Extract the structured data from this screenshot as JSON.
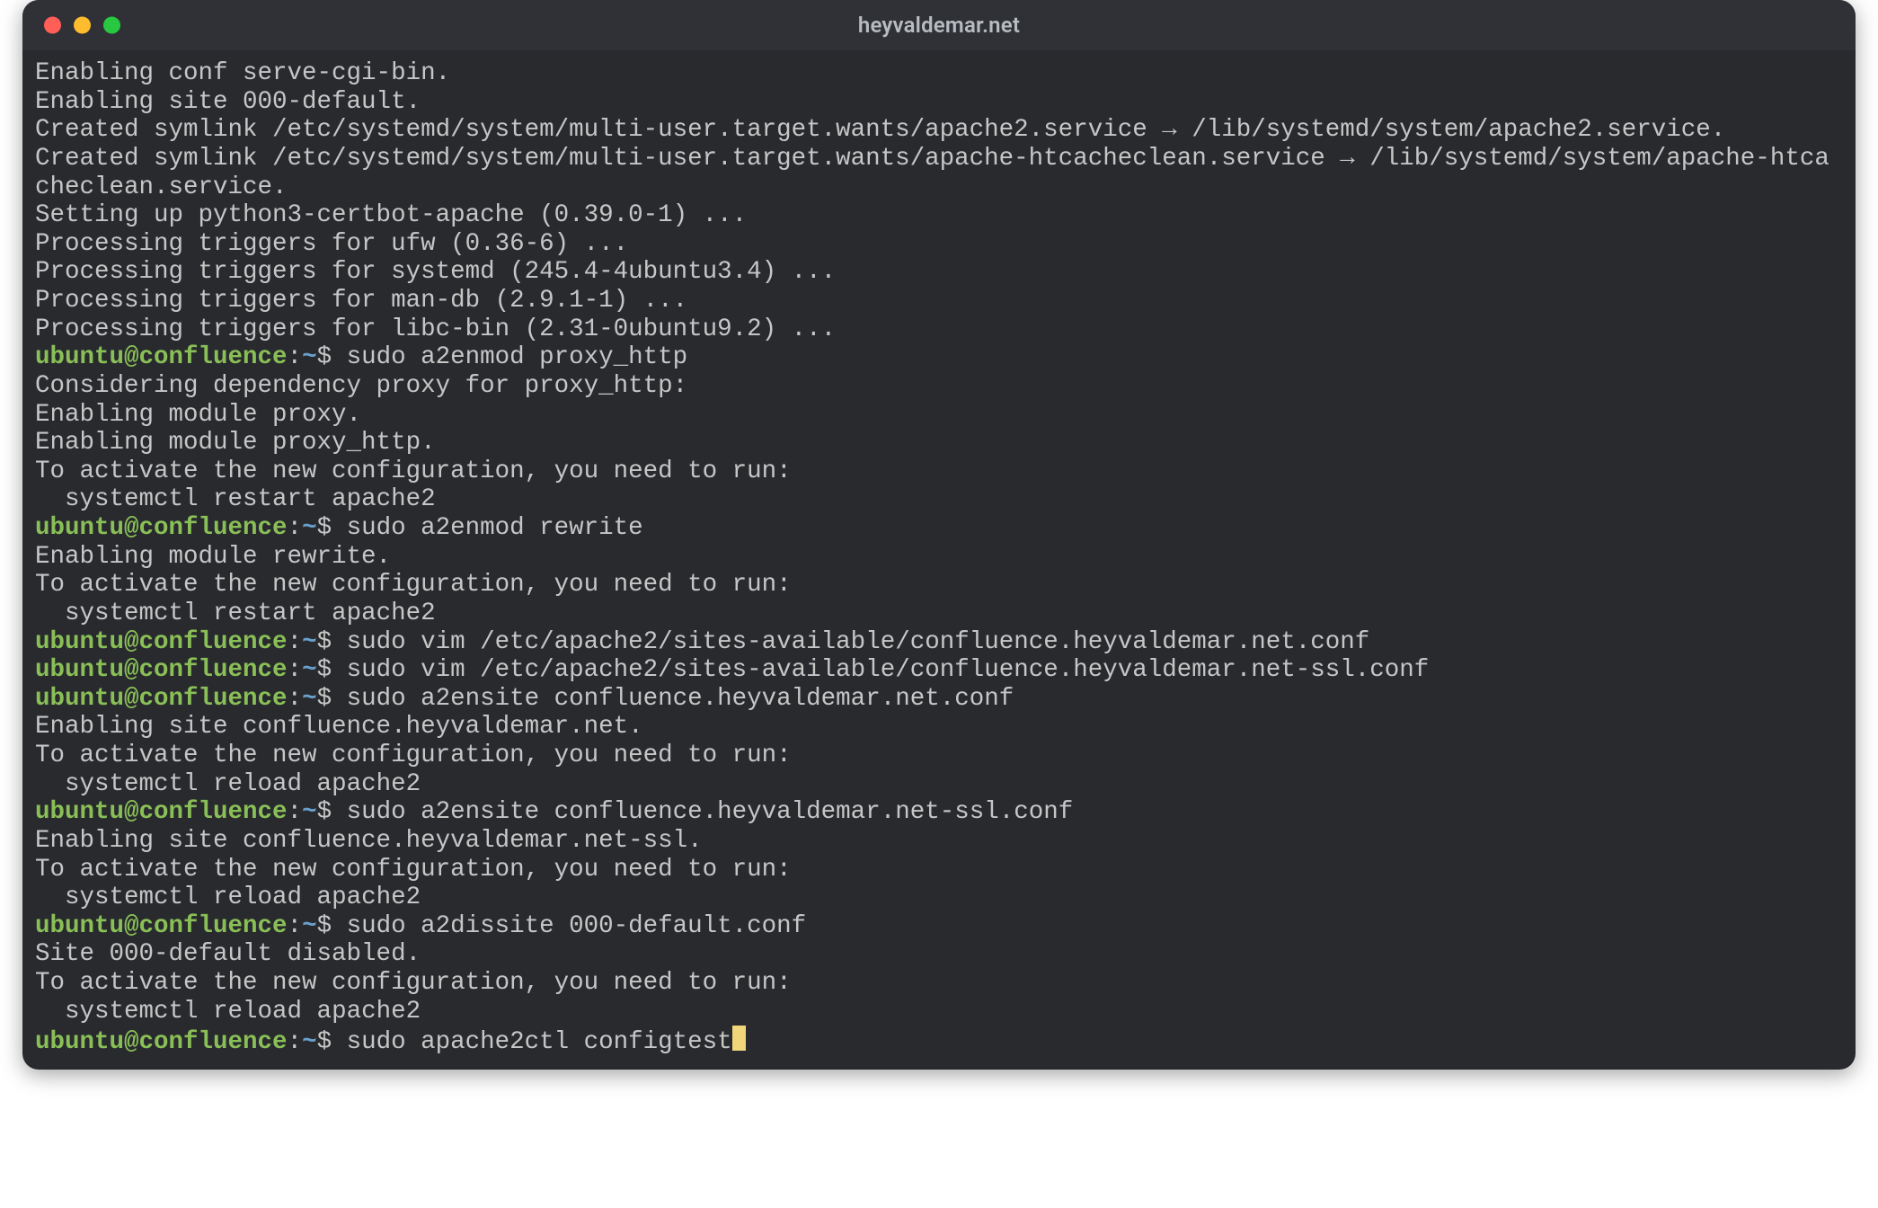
{
  "window": {
    "title": "heyvaldemar.net"
  },
  "prompt": {
    "user_host": "ubuntu@confluence",
    "colon": ":",
    "cwd": "~",
    "dollar": "$ "
  },
  "lines": [
    {
      "t": "out",
      "text": "Enabling conf serve-cgi-bin."
    },
    {
      "t": "out",
      "text": "Enabling site 000-default."
    },
    {
      "t": "out",
      "text": "Created symlink /etc/systemd/system/multi-user.target.wants/apache2.service → /lib/systemd/system/apache2.service."
    },
    {
      "t": "out",
      "text": "Created symlink /etc/systemd/system/multi-user.target.wants/apache-htcacheclean.service → /lib/systemd/system/apache-htcacheclean.service."
    },
    {
      "t": "out",
      "text": "Setting up python3-certbot-apache (0.39.0-1) ..."
    },
    {
      "t": "out",
      "text": "Processing triggers for ufw (0.36-6) ..."
    },
    {
      "t": "out",
      "text": "Processing triggers for systemd (245.4-4ubuntu3.4) ..."
    },
    {
      "t": "out",
      "text": "Processing triggers for man-db (2.9.1-1) ..."
    },
    {
      "t": "out",
      "text": "Processing triggers for libc-bin (2.31-0ubuntu9.2) ..."
    },
    {
      "t": "prompt",
      "cmd": "sudo a2enmod proxy_http"
    },
    {
      "t": "out",
      "text": "Considering dependency proxy for proxy_http:"
    },
    {
      "t": "out",
      "text": "Enabling module proxy."
    },
    {
      "t": "out",
      "text": "Enabling module proxy_http."
    },
    {
      "t": "out",
      "text": "To activate the new configuration, you need to run:"
    },
    {
      "t": "out",
      "text": "  systemctl restart apache2"
    },
    {
      "t": "prompt",
      "cmd": "sudo a2enmod rewrite"
    },
    {
      "t": "out",
      "text": "Enabling module rewrite."
    },
    {
      "t": "out",
      "text": "To activate the new configuration, you need to run:"
    },
    {
      "t": "out",
      "text": "  systemctl restart apache2"
    },
    {
      "t": "prompt",
      "cmd": "sudo vim /etc/apache2/sites-available/confluence.heyvaldemar.net.conf"
    },
    {
      "t": "prompt",
      "cmd": "sudo vim /etc/apache2/sites-available/confluence.heyvaldemar.net-ssl.conf"
    },
    {
      "t": "prompt",
      "cmd": "sudo a2ensite confluence.heyvaldemar.net.conf"
    },
    {
      "t": "out",
      "text": "Enabling site confluence.heyvaldemar.net."
    },
    {
      "t": "out",
      "text": "To activate the new configuration, you need to run:"
    },
    {
      "t": "out",
      "text": "  systemctl reload apache2"
    },
    {
      "t": "prompt",
      "cmd": "sudo a2ensite confluence.heyvaldemar.net-ssl.conf"
    },
    {
      "t": "out",
      "text": "Enabling site confluence.heyvaldemar.net-ssl."
    },
    {
      "t": "out",
      "text": "To activate the new configuration, you need to run:"
    },
    {
      "t": "out",
      "text": "  systemctl reload apache2"
    },
    {
      "t": "prompt",
      "cmd": "sudo a2dissite 000-default.conf"
    },
    {
      "t": "out",
      "text": "Site 000-default disabled."
    },
    {
      "t": "out",
      "text": "To activate the new configuration, you need to run:"
    },
    {
      "t": "out",
      "text": "  systemctl reload apache2"
    },
    {
      "t": "prompt",
      "cmd": "sudo apache2ctl configtest",
      "cursor": true
    }
  ]
}
